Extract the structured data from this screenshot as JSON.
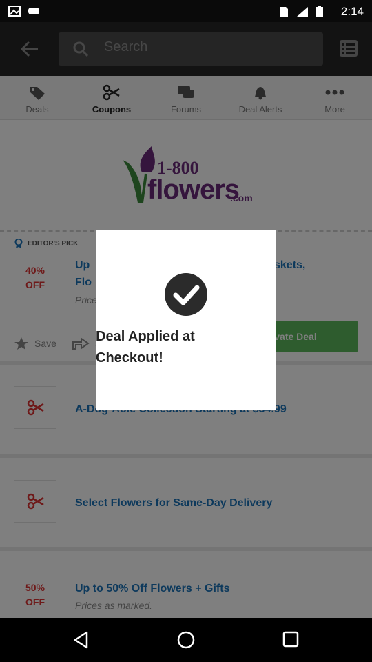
{
  "statusbar": {
    "time": "2:14"
  },
  "topbar": {
    "search_placeholder": "Search"
  },
  "tabs": [
    {
      "label": "Deals",
      "icon": "tag-icon"
    },
    {
      "label": "Coupons",
      "icon": "scissors-icon"
    },
    {
      "label": "Forums",
      "icon": "chat-icon"
    },
    {
      "label": "Deal Alerts",
      "icon": "bell-icon"
    },
    {
      "label": "More",
      "icon": "more-icon"
    }
  ],
  "brand": {
    "logo_text_top": "1-800",
    "logo_text_main": "flowers",
    "logo_text_suffix": ".com"
  },
  "editors_pick": {
    "label": "EDITOR'S PICK"
  },
  "deals": [
    {
      "badge_line1": "40%",
      "badge_line2": "OFF",
      "title_line1": "Up",
      "title_tail": "skets,",
      "title_line2": "Flo",
      "sub": "Price"
    },
    {
      "badge_icon": "scissors-icon",
      "title_line1": "A-Dog-Able Collection Starting at $34.99"
    },
    {
      "badge_icon": "scissors-icon",
      "title_line1": "Select Flowers for Same-Day Delivery"
    },
    {
      "badge_line1": "50%",
      "badge_line2": "OFF",
      "title_line1": "Up to 50% Off Flowers + Gifts",
      "sub": "Prices as marked."
    }
  ],
  "actions": {
    "save_label": "Save",
    "share_label": "S",
    "activate_label": "vate Deal"
  },
  "dialog": {
    "message_line1": "Deal Applied at",
    "message_line2": "Checkout!"
  },
  "colors": {
    "accent_blue": "#1a73b8",
    "badge_red": "#dd3333",
    "activate_green": "#5cb85c",
    "topbar": "#262626"
  }
}
